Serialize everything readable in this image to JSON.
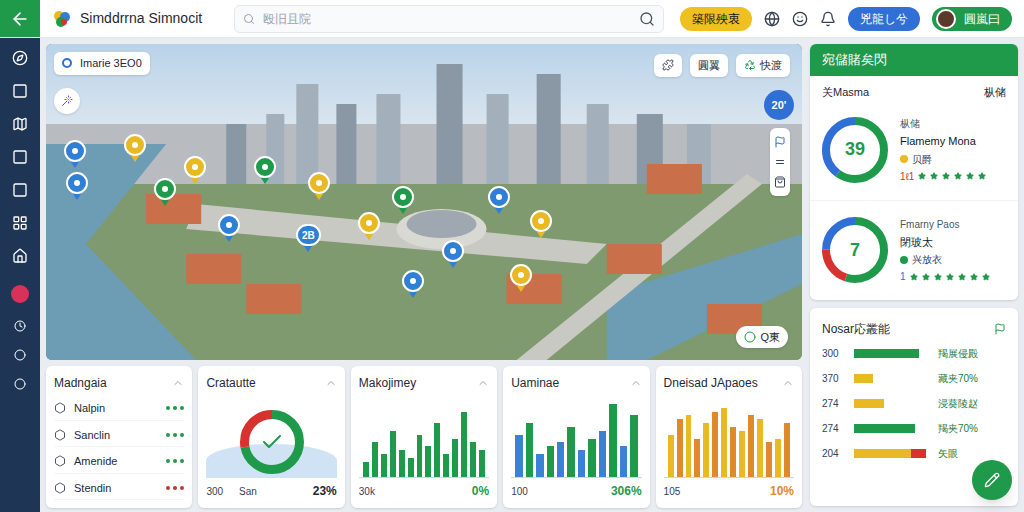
{
  "app": {
    "title": "Simddrrna Simnocit"
  },
  "search": {
    "placeholder": "殴旧且院"
  },
  "topbar": {
    "primary_button": "築限殃衷",
    "secondary_button": "兇龍し兮",
    "user": "圓嵐曰"
  },
  "map": {
    "chip": "Imarie  3EO0",
    "buttons": [
      {
        "label": "圓翼"
      },
      {
        "label": "快渡"
      }
    ],
    "zoom": "20'",
    "chip_bottom": "Q東",
    "pins": [
      {
        "kind": "icon",
        "color": "#2f7fd6"
      },
      {
        "kind": "icon",
        "color": "#e8b923"
      },
      {
        "kind": "icon",
        "color": "#2f7fd6"
      },
      {
        "kind": "icon",
        "color": "#1f9a4a"
      },
      {
        "kind": "icon",
        "color": "#e8b923"
      },
      {
        "kind": "icon",
        "color": "#1f9a4a"
      },
      {
        "kind": "icon",
        "color": "#e8b923"
      },
      {
        "kind": "text",
        "label": "2B",
        "color": "#2f7fd6"
      },
      {
        "kind": "icon",
        "color": "#2f7fd6"
      },
      {
        "kind": "icon",
        "color": "#e8b923"
      },
      {
        "kind": "icon",
        "color": "#1f9a4a"
      },
      {
        "kind": "icon",
        "color": "#2f7fd6"
      },
      {
        "kind": "icon",
        "color": "#e8b923"
      },
      {
        "kind": "icon",
        "color": "#2f7fd6"
      },
      {
        "kind": "icon",
        "color": "#2f7fd6"
      },
      {
        "kind": "icon",
        "color": "#e8b923"
      }
    ]
  },
  "cards": [
    {
      "title": "Madngaia",
      "kind": "list",
      "rows": [
        {
          "label": "Nalpin",
          "color": "#1f9a4a"
        },
        {
          "label": "Sanclin",
          "color": "#1f9a4a"
        },
        {
          "label": "Amenide",
          "color": "#1f9a4a"
        },
        {
          "label": "Stendin",
          "color": "#c0392b"
        }
      ]
    },
    {
      "title": "Cratautte",
      "kind": "donut",
      "segments": [
        {
          "color": "#1f9a4a",
          "level": 0.72
        },
        {
          "color": "#d8322f",
          "level": 0.28
        }
      ],
      "footer": [
        "300",
        "San"
      ],
      "footer_right": "23%",
      "footer_right_color": "#1f2937"
    },
    {
      "title": "Makojimey",
      "kind": "bars",
      "series": [
        {
          "color": "#1f9a4a",
          "values": [
            20,
            45,
            30,
            60,
            35,
            25,
            55,
            40,
            70,
            30,
            50,
            85,
            45,
            35
          ]
        }
      ],
      "footer": [
        "30k"
      ],
      "footer_right": "0%",
      "footer_right_color": "#1f9a4a"
    },
    {
      "title": "Uaminae",
      "kind": "bars",
      "series": [
        {
          "color": "#3b82d6",
          "values": [
            55,
            30,
            45,
            35,
            60,
            40
          ]
        },
        {
          "color": "#1f9a4a",
          "values": [
            70,
            40,
            65,
            50,
            95,
            80
          ]
        }
      ],
      "footer": [
        "100"
      ],
      "footer_right": "306%",
      "footer_right_color": "#1f9a4a"
    },
    {
      "title": "Dneisad JApaoes",
      "kind": "bars",
      "series": [
        {
          "color": "#e8b923",
          "values": [
            55,
            80,
            70,
            90,
            60,
            75,
            50
          ]
        },
        {
          "color": "#e0892b",
          "values": [
            75,
            50,
            85,
            65,
            80,
            45,
            70
          ]
        }
      ],
      "footer": [
        "105"
      ],
      "footer_right": "10%",
      "footer_right_color": "#e0892b"
    }
  ],
  "summary": {
    "title": "宛儲賭矣閃",
    "left": "关Masma",
    "right": "枞储",
    "items": [
      {
        "center": "39",
        "segments": [
          {
            "color": "#1f9a4a",
            "level": 0.6
          },
          {
            "color": "#2f6fd6",
            "level": 0.4
          }
        ],
        "top": "枞储",
        "name": "Flamemy Mona",
        "tag": "贝爵",
        "tag_color": "#e8b923",
        "rating": "1ℓ1",
        "rating_color": "#c0392b",
        "stars": 6
      },
      {
        "center": "7",
        "segments": [
          {
            "color": "#1f9a4a",
            "level": 0.55
          },
          {
            "color": "#d8322f",
            "level": 0.2
          },
          {
            "color": "#2f6fd6",
            "level": 0.25
          }
        ],
        "top": "Fmarny Paos",
        "name": "閉玻太",
        "tag": "兴放衣",
        "tag_color": "#1f9a4a",
        "rating": "1",
        "rating_color": "#2f6fd6",
        "stars": 7
      }
    ]
  },
  "stats": {
    "title": "Nosar応叢能",
    "rows": [
      {
        "value": "300",
        "segments": [
          {
            "color": "#1f9a4a",
            "level": 0.85
          }
        ],
        "label": "羯展侵殿"
      },
      {
        "value": "370",
        "segments": [
          {
            "color": "#e8b923",
            "level": 0.25
          }
        ],
        "label": "藏夹70%"
      },
      {
        "value": "274",
        "segments": [
          {
            "color": "#e8b923",
            "level": 0.4
          }
        ],
        "label": "浸葵陵赵"
      },
      {
        "value": "274",
        "segments": [
          {
            "color": "#1f9a4a",
            "level": 0.8
          }
        ],
        "label": "羯夹70%"
      },
      {
        "value": "204",
        "segments": [
          {
            "color": "#e8b923",
            "level": 0.75
          },
          {
            "color": "#d8322f",
            "level": 0.2
          }
        ],
        "label": "矢眼"
      }
    ]
  }
}
